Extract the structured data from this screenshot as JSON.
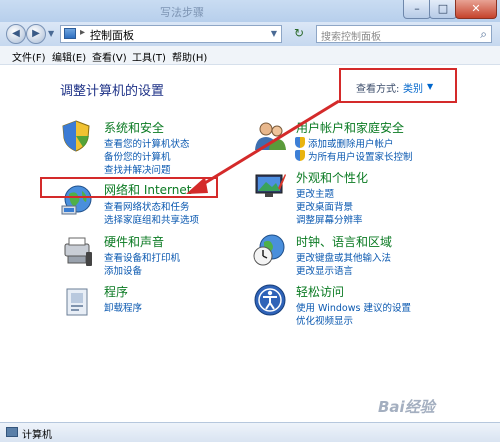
{
  "window": {
    "faded_title": "写法步骤"
  },
  "nav": {
    "address_path": "控制面板",
    "address_separator": "▸",
    "search_placeholder": "搜索控制面板"
  },
  "menu": [
    "文件(F)",
    "编辑(E)",
    "查看(V)",
    "工具(T)",
    "帮助(H)"
  ],
  "main": {
    "heading": "调整计算机的设置",
    "view_by_label": "查看方式:",
    "view_by_value": "类别"
  },
  "categories": {
    "system_security": {
      "title": "系统和安全",
      "links": [
        "查看您的计算机状态",
        "备份您的计算机",
        "查找并解决问题"
      ]
    },
    "network": {
      "title": "网络和 Internet",
      "links": [
        "查看网络状态和任务",
        "选择家庭组和共享选项"
      ]
    },
    "hardware": {
      "title": "硬件和声音",
      "links": [
        "查看设备和打印机",
        "添加设备"
      ]
    },
    "programs": {
      "title": "程序",
      "links": [
        "卸载程序"
      ]
    },
    "user_accounts": {
      "title": "用户帐户和家庭安全",
      "links": [
        "添加或删除用户帐户",
        "为所有用户设置家长控制"
      ]
    },
    "appearance": {
      "title": "外观和个性化",
      "links": [
        "更改主题",
        "更改桌面背景",
        "调整屏幕分辨率"
      ]
    },
    "clock": {
      "title": "时钟、语言和区域",
      "links": [
        "更改键盘或其他输入法",
        "更改显示语言"
      ]
    },
    "ease": {
      "title": "轻松访问",
      "links": [
        "使用 Windows 建议的设置",
        "优化视频显示"
      ]
    }
  },
  "status": {
    "text": "计算机"
  },
  "watermark": "Bai经验",
  "colors": {
    "annotation_red": "#d42a2a",
    "category_green": "#0a7a22",
    "link_blue": "#0a58b0"
  }
}
